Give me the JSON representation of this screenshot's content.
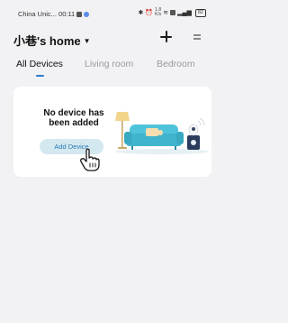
{
  "status_bar": {
    "carrier_time": "China Unic... 00:11",
    "speed_value": "1.8",
    "speed_unit": "K/s",
    "battery": "82"
  },
  "header": {
    "title": "小巷's home",
    "caret": "▼"
  },
  "tabs": [
    {
      "label": "All Devices",
      "active": true
    },
    {
      "label": "Living room",
      "active": false
    },
    {
      "label": "Bedroom",
      "active": false
    }
  ],
  "empty_state": {
    "message": "No device has been added",
    "add_button_label": "Add Device"
  },
  "colors": {
    "accent": "#2f7ad1",
    "button_bg": "#d4e8f0",
    "button_text": "#2b79b5",
    "sofa": "#4fc3d9",
    "background": "#f2f2f4"
  }
}
